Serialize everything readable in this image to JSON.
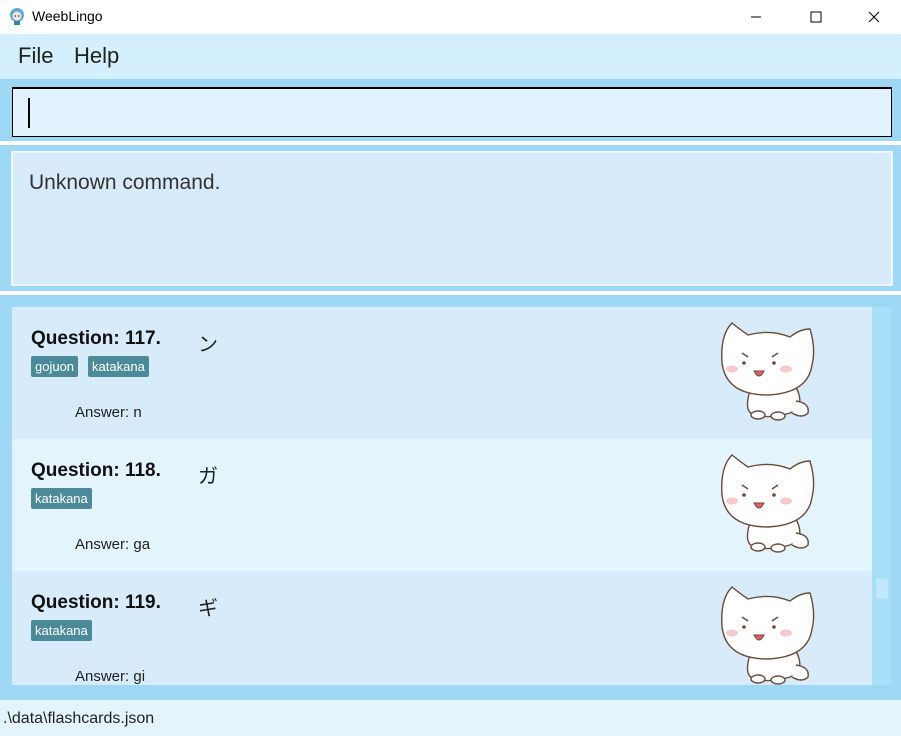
{
  "window": {
    "title": "WeebLingo",
    "icon": "weeblingo-app-icon",
    "controls": [
      "minimize-icon",
      "maximize-icon",
      "close-icon"
    ]
  },
  "menu": {
    "file": "File",
    "help": "Help"
  },
  "command_box": {
    "value": "",
    "placeholder": ""
  },
  "result": {
    "text": "Unknown command."
  },
  "flashcards": [
    {
      "question": "Question: 117.",
      "character": "ン",
      "tags": [
        "gojuon",
        "katakana"
      ],
      "answer": "Answer: n"
    },
    {
      "question": "Question: 118.",
      "character": "ガ",
      "tags": [
        "katakana"
      ],
      "answer": "Answer: ga"
    },
    {
      "question": "Question: 119.",
      "character": "ギ",
      "tags": [
        "katakana"
      ],
      "answer": "Answer: gi"
    }
  ],
  "status_bar": {
    "path": ".\\data\\flashcards.json"
  },
  "colors": {
    "menu_bg": "#d4effd",
    "panel_bg": "#9ed8f5",
    "card_alt_1": "#d8ebfb",
    "card_alt_2": "#e3f4fd",
    "tag_bg": "#4c8a99"
  }
}
